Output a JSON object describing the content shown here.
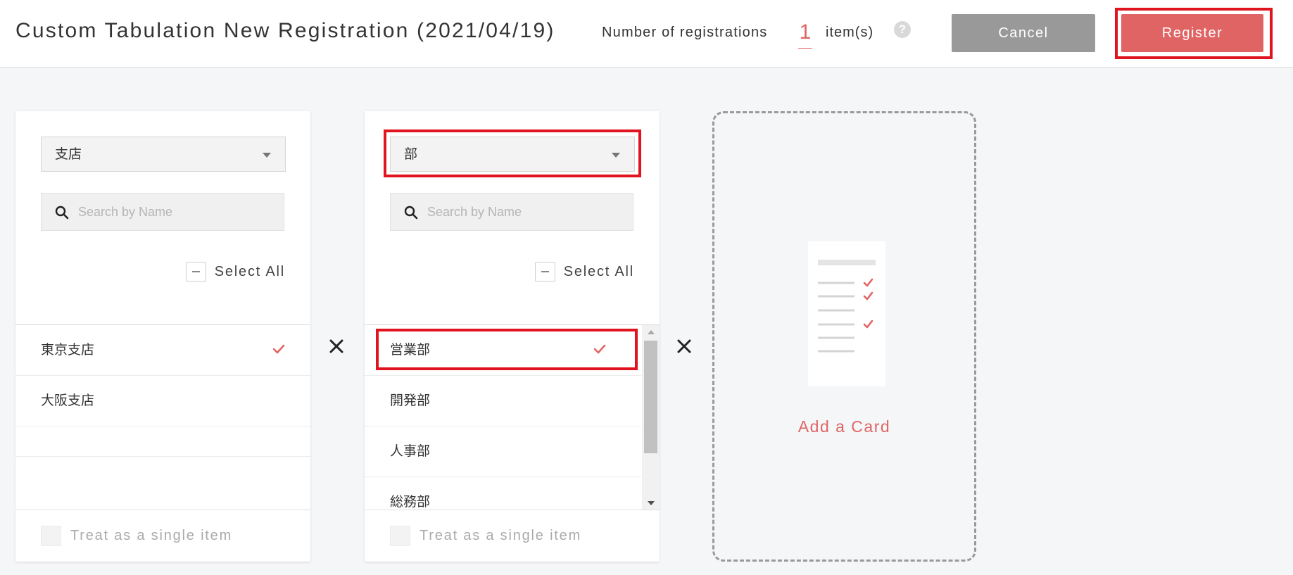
{
  "header": {
    "title": "Custom Tabulation New Registration (2021/04/19)",
    "registrations_label": "Number of registrations",
    "registrations_count": "1",
    "registrations_unit": "item(s)",
    "help_icon": "?",
    "cancel_label": "Cancel",
    "register_label": "Register"
  },
  "cards": [
    {
      "dropdown_value": "支店",
      "search_placeholder": "Search by Name",
      "select_all_label": "Select All",
      "items": [
        {
          "label": "東京支店",
          "checked": true
        },
        {
          "label": "大阪支店",
          "checked": false
        }
      ],
      "single_item_label": "Treat as a single item"
    },
    {
      "dropdown_value": "部",
      "search_placeholder": "Search by Name",
      "select_all_label": "Select All",
      "items": [
        {
          "label": "営業部",
          "checked": true
        },
        {
          "label": "開発部",
          "checked": false
        },
        {
          "label": "人事部",
          "checked": false
        },
        {
          "label": "総務部",
          "checked": false
        }
      ],
      "single_item_label": "Treat as a single item"
    }
  ],
  "add_card": {
    "label": "Add a Card"
  },
  "colors": {
    "accent": "#e06464",
    "cancel_gray": "#999999",
    "highlight_red": "#e0141e",
    "background": "#f5f6f8"
  },
  "icons": {
    "help": "question-circle-icon",
    "search": "magnifier-icon",
    "check": "check-icon",
    "cross": "times-icon",
    "dropdown": "caret-down-icon",
    "select_all": "minus-square-icon",
    "add_card": "checklist-document-icon"
  }
}
